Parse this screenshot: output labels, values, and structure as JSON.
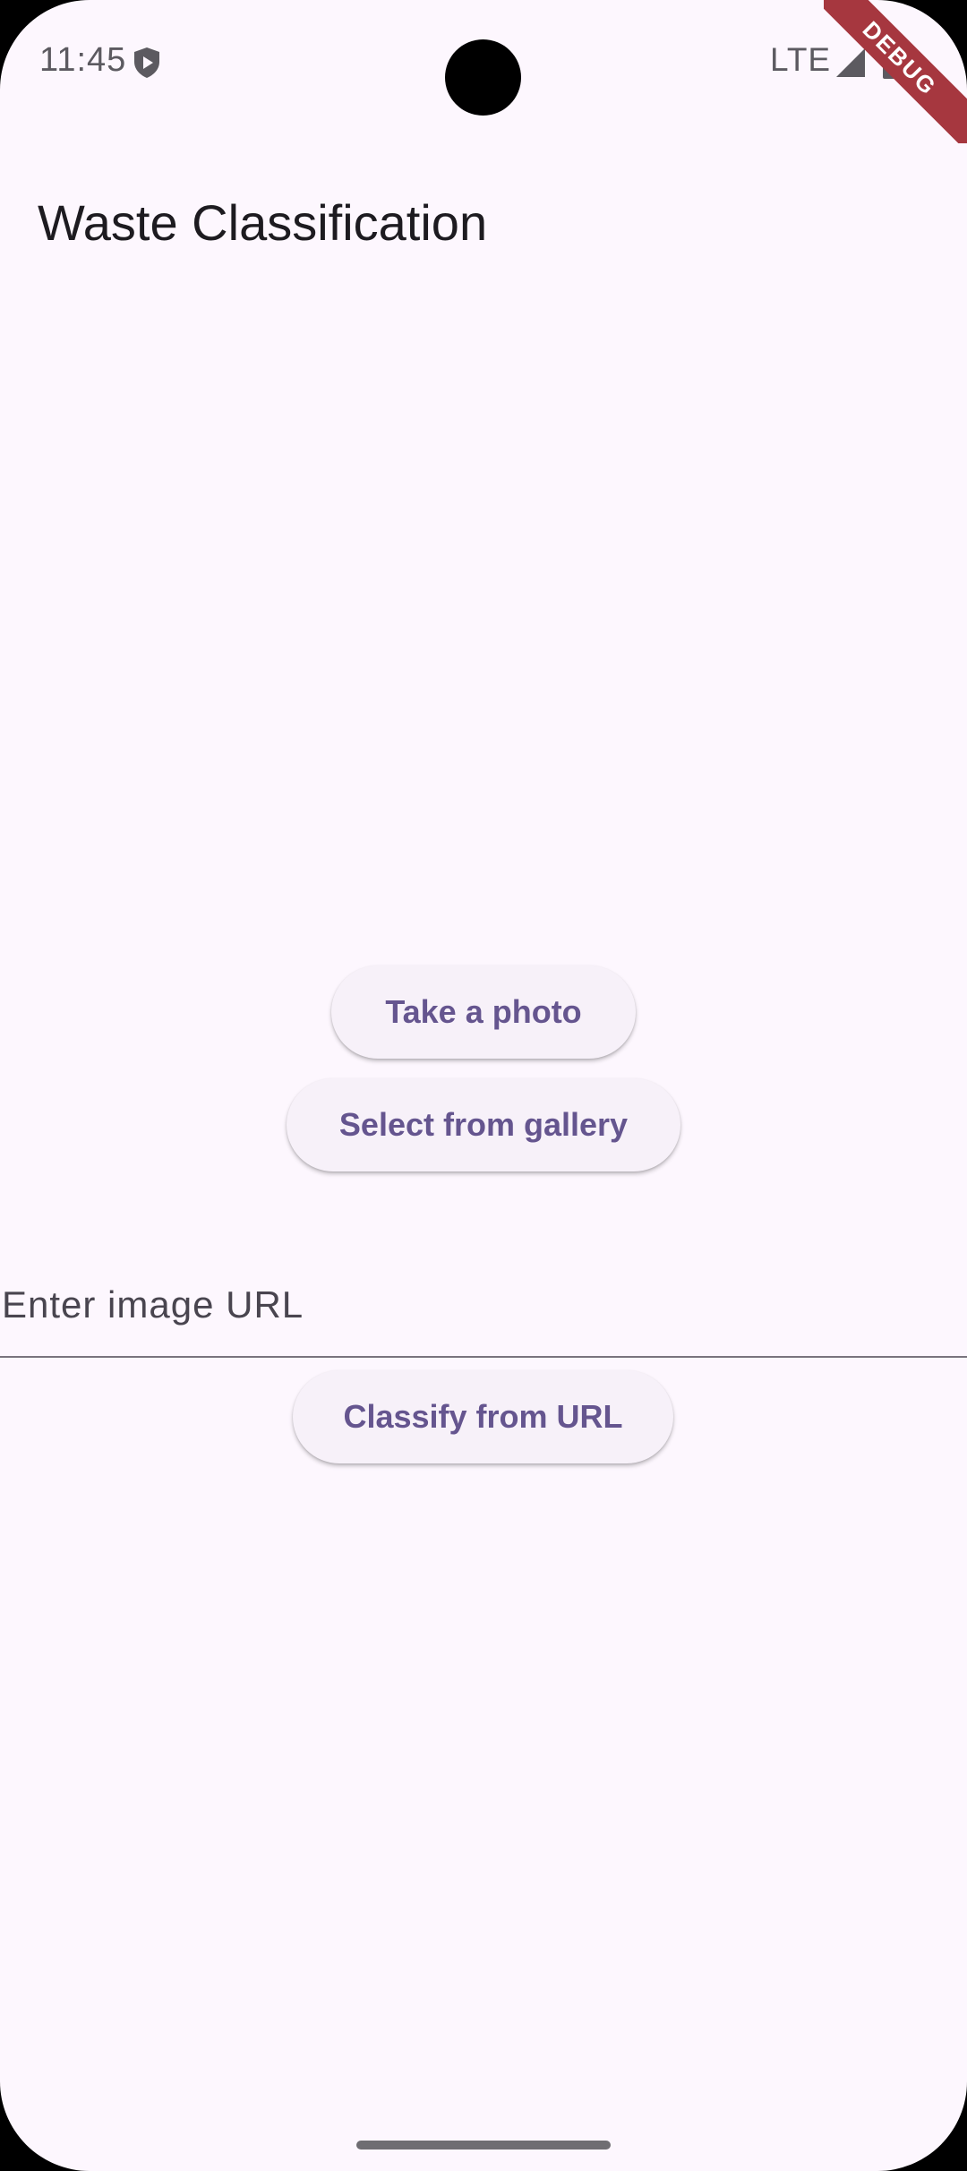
{
  "status_bar": {
    "time": "11:45",
    "network": "LTE",
    "icons": [
      "shield-play-icon",
      "signal-icon",
      "battery-icon"
    ]
  },
  "debug_banner": {
    "label": "DEBUG",
    "color": "#a6373f"
  },
  "app_bar": {
    "title": "Waste Classification"
  },
  "actions": {
    "take_photo_label": "Take a photo",
    "select_gallery_label": "Select from gallery",
    "classify_url_label": "Classify from URL"
  },
  "url_input": {
    "placeholder": "Enter image URL",
    "value": ""
  },
  "colors": {
    "background": "#fdf7fe",
    "accent": "#65558f",
    "button_bg": "#f7f1f9",
    "text_primary": "#1d1b20"
  }
}
